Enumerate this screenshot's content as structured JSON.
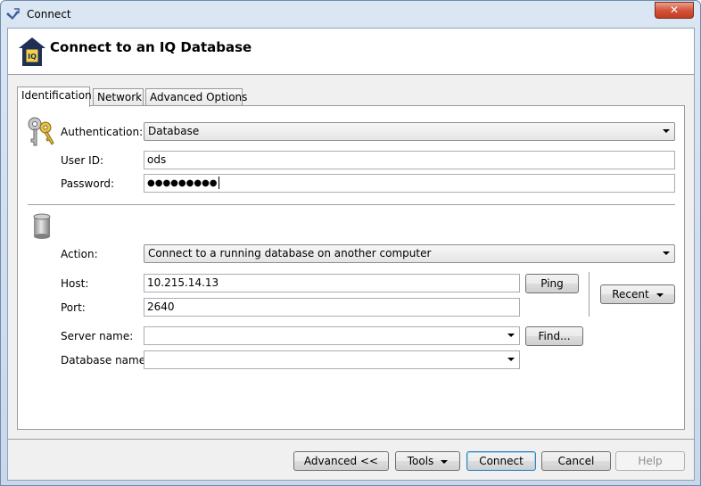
{
  "window": {
    "title": "Connect",
    "close_label": "✕"
  },
  "header": {
    "title": "Connect to an IQ Database"
  },
  "tabs": [
    {
      "label": "Identification",
      "active": true
    },
    {
      "label": "Network",
      "active": false
    },
    {
      "label": "Advanced Options",
      "active": false
    }
  ],
  "identification": {
    "authentication": {
      "label": "Authentication:",
      "value": "Database"
    },
    "user_id": {
      "label": "User ID:",
      "value": "ods"
    },
    "password": {
      "label": "Password:",
      "value": "●●●●●●●●●"
    }
  },
  "connection": {
    "action": {
      "label": "Action:",
      "value": "Connect to a running database on another computer"
    },
    "host": {
      "label": "Host:",
      "value": "10.215.14.13"
    },
    "port": {
      "label": "Port:",
      "value": "2640"
    },
    "server_name": {
      "label": "Server name:",
      "value": ""
    },
    "database_name": {
      "label": "Database name:",
      "value": ""
    },
    "ping_label": "Ping",
    "find_label": "Find...",
    "recent_label": "Recent"
  },
  "footer": {
    "advanced_label": "Advanced <<",
    "tools_label": "Tools",
    "connect_label": "Connect",
    "cancel_label": "Cancel",
    "help_label": "Help"
  },
  "icons": {
    "window": "connect-plug-icon",
    "header": "iq-database-house-icon",
    "auth": "keys-icon",
    "action": "database-cylinder-icon"
  }
}
